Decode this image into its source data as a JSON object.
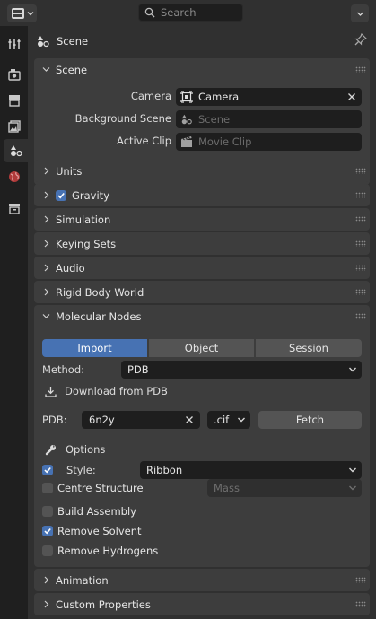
{
  "header": {
    "search_placeholder": "Search"
  },
  "context": {
    "title": "Scene"
  },
  "panels": {
    "scene": {
      "title": "Scene",
      "camera_label": "Camera",
      "camera_value": "Camera",
      "background_label": "Background Scene",
      "background_placeholder": "Scene",
      "clip_label": "Active Clip",
      "clip_placeholder": "Movie Clip"
    },
    "units": "Units",
    "gravity": "Gravity",
    "gravity_enabled": true,
    "simulation": "Simulation",
    "keying_sets": "Keying Sets",
    "audio": "Audio",
    "rigid_body_world": "Rigid Body World",
    "molecular": {
      "title": "Molecular Nodes",
      "tabs": [
        "Import",
        "Object",
        "Session"
      ],
      "active_tab": "Import",
      "method_label": "Method:",
      "method_value": "PDB",
      "download_label": "Download from PDB",
      "pdb_label": "PDB:",
      "pdb_value": "6n2y",
      "format_value": ".cif",
      "fetch_label": "Fetch",
      "options_label": "Options",
      "style_label": "Style:",
      "style_value": "Ribbon",
      "style_checked": true,
      "centre_label": "Centre Structure",
      "centre_checked": false,
      "centre_value": "Mass",
      "assembly_label": "Build Assembly",
      "assembly_checked": false,
      "solvent_label": "Remove Solvent",
      "solvent_checked": true,
      "hydrogens_label": "Remove Hydrogens",
      "hydrogens_checked": false
    },
    "animation": "Animation",
    "custom_properties": "Custom Properties"
  },
  "colors": {
    "accent": "#4772b3",
    "panel": "#3d3d3d",
    "background": "#303030",
    "field": "#1e1e1e"
  }
}
